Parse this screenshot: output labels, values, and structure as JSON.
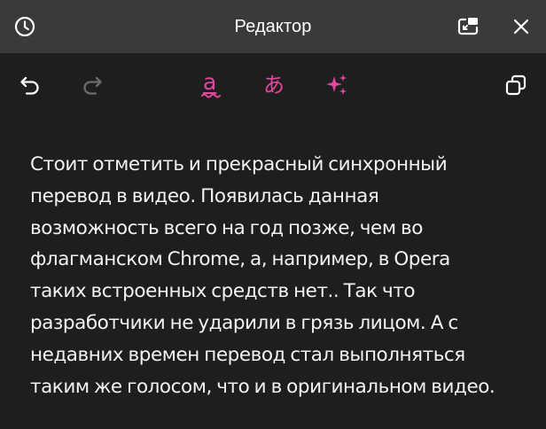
{
  "window": {
    "title": "Редактор"
  },
  "icons": {
    "history": "clock-icon",
    "pip": "picture-in-picture-icon",
    "close": "close-icon",
    "undo": "undo-icon",
    "redo": "redo-icon",
    "spellcheck": "spellcheck-icon",
    "translate": "translate-icon",
    "ai": "sparkles-icon",
    "copy": "copy-icon"
  },
  "toolbar": {
    "spell_glyph": "a",
    "translate_glyph": "あ"
  },
  "colors": {
    "titlebar": "#3a3a3d",
    "background": "#1e1e1f",
    "accent": "#e0489d",
    "text": "#f2f2f2",
    "disabled_icon": "#6b6b6e"
  },
  "content": {
    "lines": [
      "Стоит отметить и прекрасный синхронный",
      "перевод в видео. Появилась данная",
      "возможность всего на год позже, чем во",
      "флагманском Chrome, а, например, в Opera",
      "таких встроенных средств нет.. Так что",
      "разработчики не ударили в грязь лицом. А с",
      "недавних времен перевод стал выполняться",
      "таким же голосом, что и в оригинальном видео."
    ]
  }
}
